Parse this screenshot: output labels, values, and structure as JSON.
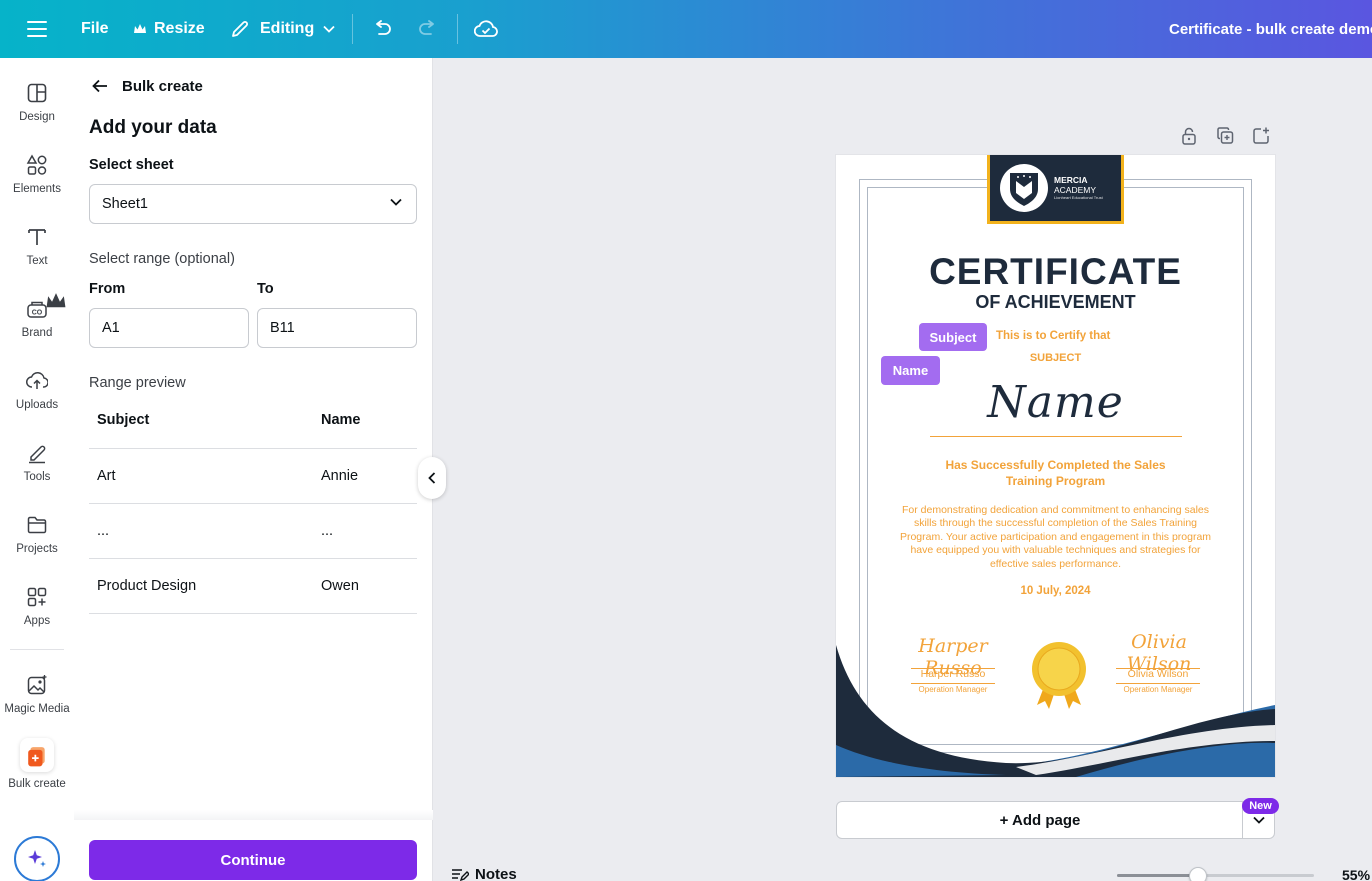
{
  "topbar": {
    "file_label": "File",
    "resize_label": "Resize",
    "mode_label": "Editing",
    "doc_title": "Certificate - bulk create demo"
  },
  "rail": {
    "items": [
      {
        "label": "Design",
        "icon": "design-icon"
      },
      {
        "label": "Elements",
        "icon": "elements-icon"
      },
      {
        "label": "Text",
        "icon": "text-icon"
      },
      {
        "label": "Brand",
        "icon": "brand-icon"
      },
      {
        "label": "Uploads",
        "icon": "uploads-icon"
      },
      {
        "label": "Tools",
        "icon": "tools-icon"
      },
      {
        "label": "Projects",
        "icon": "projects-icon"
      },
      {
        "label": "Apps",
        "icon": "apps-icon"
      },
      {
        "label": "Magic Media",
        "icon": "magic-media-icon"
      },
      {
        "label": "Bulk create",
        "icon": "bulk-create-icon"
      }
    ]
  },
  "panel": {
    "back_label": "Bulk create",
    "heading": "Add your data",
    "select_sheet_label": "Select sheet",
    "sheet_value": "Sheet1",
    "range_label": "Select range (optional)",
    "from_label": "From",
    "to_label": "To",
    "from_value": "A1",
    "to_value": "B11",
    "preview_label": "Range preview",
    "columns": [
      "Subject",
      "Name"
    ],
    "rows": [
      [
        "Art",
        "Annie"
      ],
      [
        "...",
        "..."
      ],
      [
        "Product Design",
        "Owen"
      ]
    ],
    "continue_label": "Continue"
  },
  "certificate": {
    "logo_line1": "MERCIA",
    "logo_line2": "ACADEMY",
    "logo_line3": "Lionheart Educational Trust",
    "title": "CERTIFICATE",
    "subtitle": "OF ACHIEVEMENT",
    "tag_subject": "Subject",
    "tag_name": "Name",
    "certify_text": "This is to Certify that",
    "subject_text": "SUBJECT",
    "name_text": "Name",
    "completed_text_1": "Has Successfully Completed the Sales",
    "completed_text_2": "Training Program",
    "paragraph": "For demonstrating dedication and commitment to enhancing sales skills through the successful completion of the Sales Training Program. Your active participation and engagement in this program have equipped you with valuable techniques and strategies for effective sales performance.",
    "date": "10 July, 2024",
    "sig1_script": "Harper Russo",
    "sig1_name": "Harper Russo",
    "sig1_role": "Operation Manager",
    "sig2_script": "Olivia Wilson",
    "sig2_name": "Olivia Wilson",
    "sig2_role": "Operation Manager"
  },
  "canvas": {
    "add_page_label": "+ Add page",
    "new_badge": "New",
    "notes_label": "Notes",
    "zoom_label": "55%",
    "zoom_percent": 55
  },
  "colors": {
    "accent": "#7d2ae8",
    "tag": "#a36cf0",
    "cert_navy": "#1e2b3c",
    "cert_orange": "#f2a33a"
  }
}
